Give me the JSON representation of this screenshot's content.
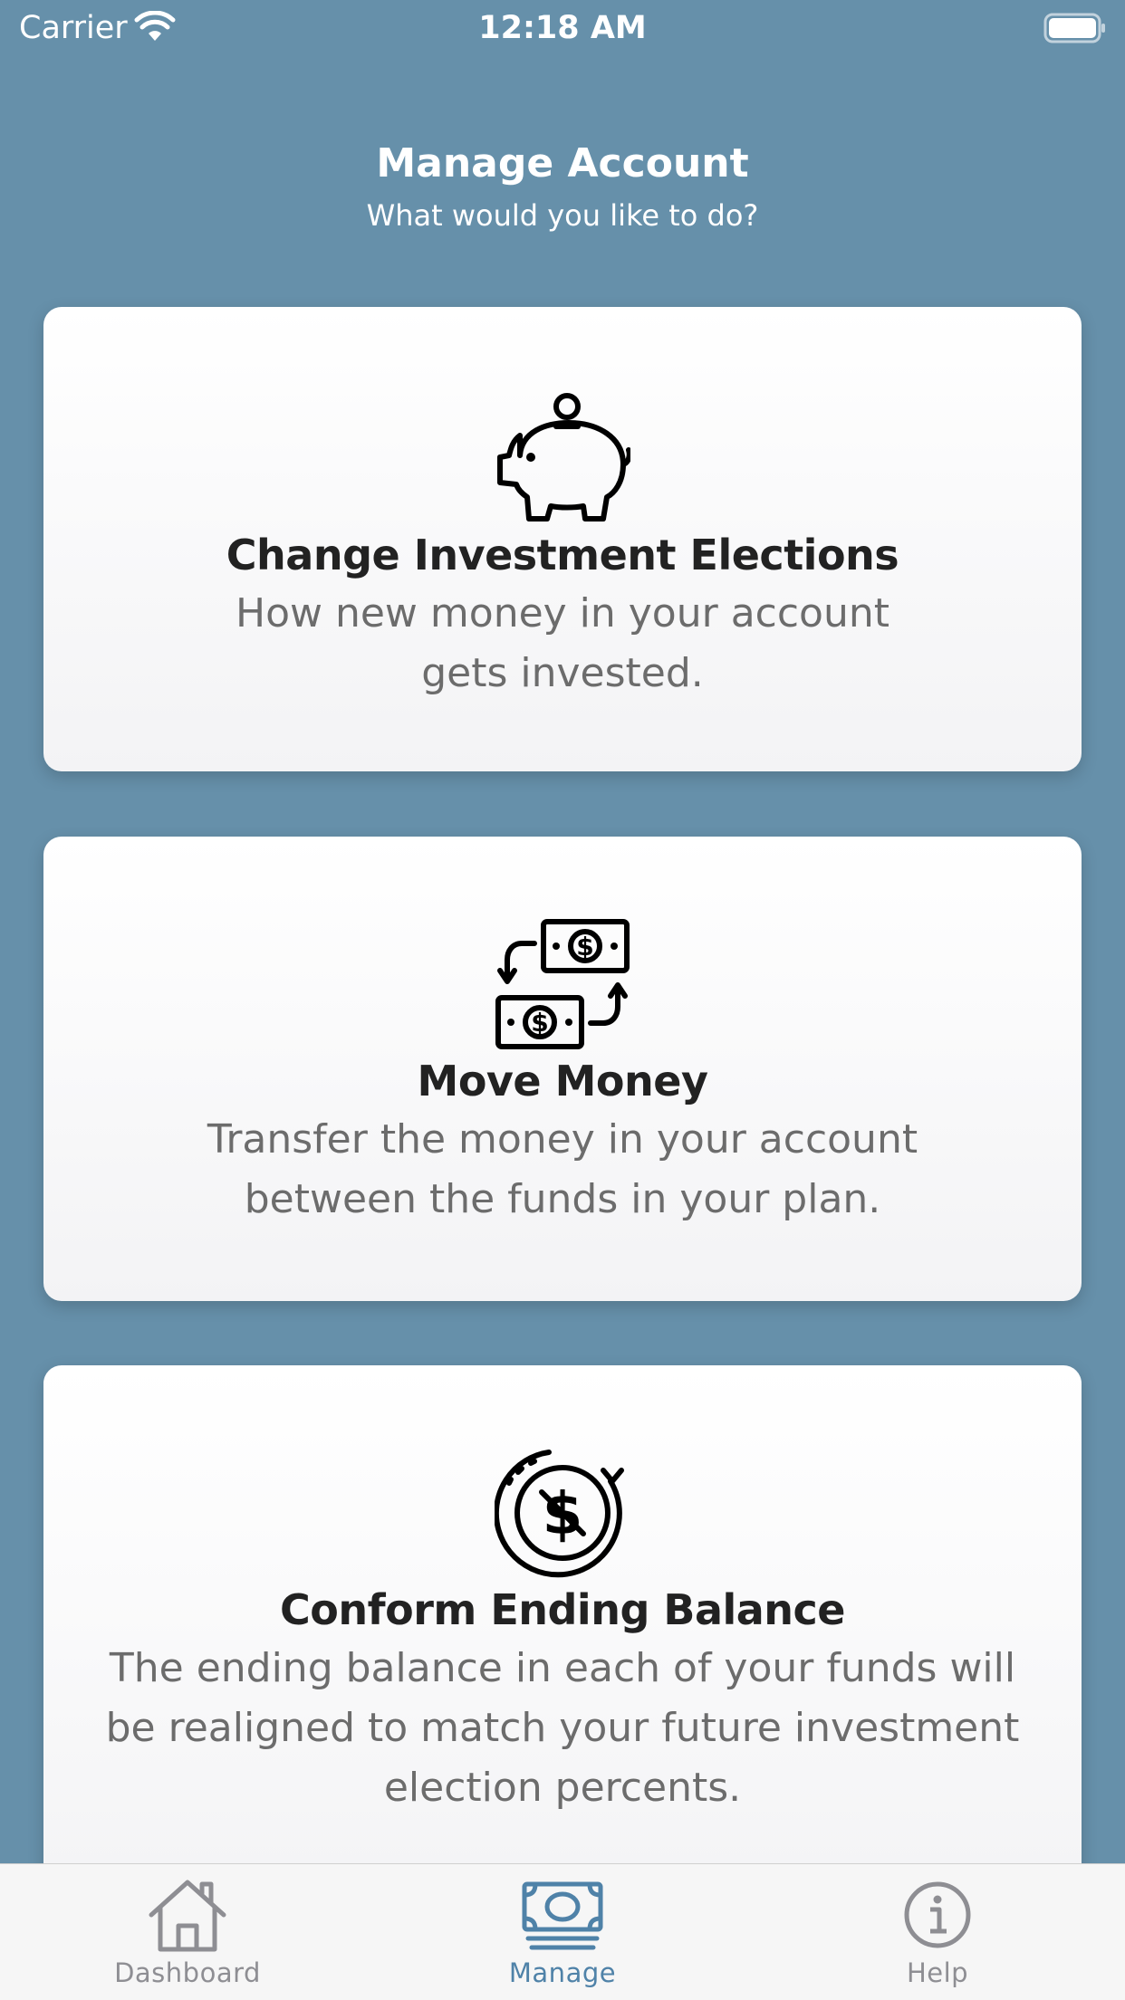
{
  "status_bar": {
    "carrier": "Carrier",
    "time": "12:18 AM",
    "icons": [
      "wifi-icon",
      "battery-icon"
    ]
  },
  "header": {
    "title": "Manage Account",
    "subtitle": "What would you like to do?"
  },
  "cards": [
    {
      "icon": "piggy-bank-icon",
      "title": "Change Investment Elections",
      "description": "How new money in your account gets invested."
    },
    {
      "icon": "money-transfer-icon",
      "title": "Move Money",
      "description": "Transfer the money in your account between the funds in your plan."
    },
    {
      "icon": "dollar-rebalance-icon",
      "title": "Conform Ending Balance",
      "description": "The ending balance in each of your funds will be realigned to match your future investment election percents."
    }
  ],
  "tab_bar": {
    "items": [
      {
        "label": "Dashboard",
        "icon": "home-icon",
        "selected": false
      },
      {
        "label": "Manage",
        "icon": "money-icon",
        "selected": true
      },
      {
        "label": "Help",
        "icon": "info-icon",
        "selected": false
      }
    ],
    "selected_color": "#4f82a8",
    "unselected_color": "#8e8e93"
  },
  "colors": {
    "background": "#6690aa",
    "card_background": "#ffffff",
    "title_text": "#222222",
    "description_text": "#6c6c6c"
  }
}
